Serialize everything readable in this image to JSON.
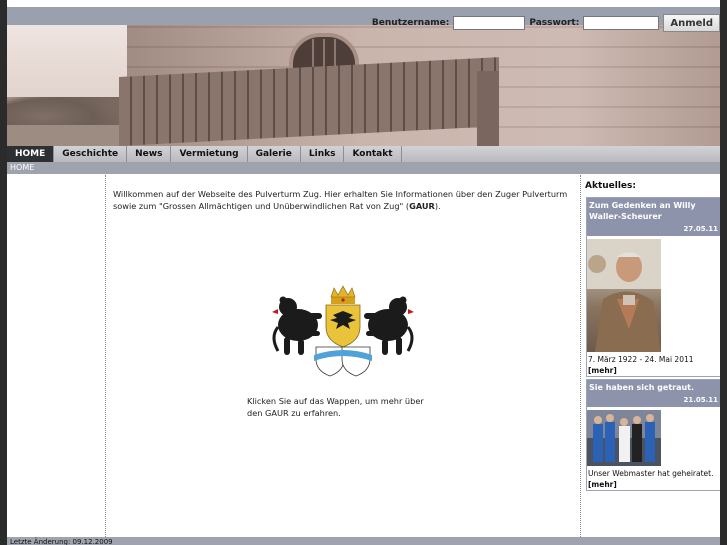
{
  "login": {
    "username_label": "Benutzername:",
    "username_value": "",
    "password_label": "Passwort:",
    "password_value": "",
    "submit_label": "Anmeld"
  },
  "nav": {
    "items": [
      {
        "label": "HOME",
        "active": true
      },
      {
        "label": "Geschichte",
        "active": false
      },
      {
        "label": "News",
        "active": false
      },
      {
        "label": "Vermietung",
        "active": false
      },
      {
        "label": "Galerie",
        "active": false
      },
      {
        "label": "Links",
        "active": false
      },
      {
        "label": "Kontakt",
        "active": false
      }
    ]
  },
  "breadcrumb": "HOME",
  "main": {
    "intro_part1": "Willkommen auf der Webseite des Pulverturm Zug. Hier erhalten Sie Informationen über den Zuger Pulverturm sowie zum \"Grossen Allmächtigen und Unüberwindlichen Rat von Zug\" (",
    "intro_bold": "GAUR",
    "intro_part2": ").",
    "crest_caption": "Klicken Sie auf das Wappen, um mehr über den GAUR zu erfahren."
  },
  "sidebar": {
    "title": "Aktuelles:",
    "news": [
      {
        "headline": "Zum Gedenken an Willy Waller-Scheurer",
        "date": "27.05.11",
        "text": "7. März 1922 - 24. Mai 2011",
        "more": "[mehr]"
      },
      {
        "headline": "Sie haben sich getraut.",
        "date": "21.05.11",
        "text": "Unser Webmaster hat geheiratet.",
        "more": "[mehr]"
      }
    ]
  },
  "footer": {
    "last_change": "Letzte Änderung: 09.12.2009"
  },
  "colors": {
    "nav_active_bg": "#2e2f33",
    "news_header_bg": "#8d93ab",
    "bar_bg": "#9fa3ad"
  }
}
